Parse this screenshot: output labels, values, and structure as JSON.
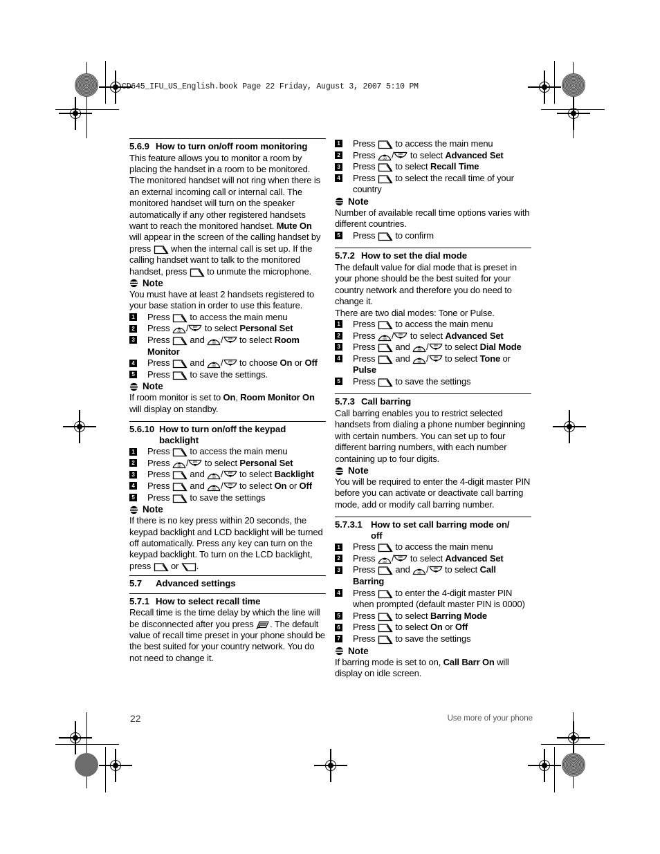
{
  "header": {
    "file_line": "CD645_IFU_US_English.book  Page 22  Friday, August 3, 2007  5:10 PM"
  },
  "footer": {
    "page_number": "22",
    "running_head": "Use more of your phone"
  },
  "icons": {
    "soft_key_left": "left-softkey-icon",
    "soft_key_right": "right-softkey-icon",
    "nav_up": "nav-up-cid-key-icon",
    "nav_down": "nav-down-pbk-key-icon",
    "recall": "recall-flash-key-icon",
    "note": "note-bullet-icon"
  },
  "left_column": {
    "s569": {
      "number": "5.6.9",
      "title": "How to turn on/off room monitoring",
      "paragraph_1a": "This feature allows you to monitor a room by placing the handset in a room to be monitored. The monitored handset will not ring when there is an external incoming call or internal call.  The monitored handset will turn on the speaker automatically if any other registered handsets want to reach the monitored handset. ",
      "mute_on": "Mute On",
      "paragraph_1b": " will appear in the screen of the calling handset by press ",
      "paragraph_1c": " when the internal call is set up. If the calling handset want to talk to the monitored handset, press ",
      "paragraph_1d": " to unmute the microphone.",
      "note_label": "Note",
      "note_text": "You must have at least 2 handsets registered to your base station in order to use this feature.",
      "steps": [
        {
          "n": "1",
          "pre": "Press ",
          "icons": [
            "soft_l"
          ],
          "post": " to access the main menu"
        },
        {
          "n": "2",
          "pre": "Press ",
          "icons": [
            "nav"
          ],
          "post": " to select ",
          "bold": "Personal Set"
        },
        {
          "n": "3",
          "pre": "Press ",
          "icons": [
            "soft_l",
            "nav"
          ],
          "mid": " and ",
          "post": " to select ",
          "bold": "Room",
          "cont": "Monitor"
        },
        {
          "n": "4",
          "pre": "Press ",
          "icons": [
            "soft_l",
            "nav"
          ],
          "mid": " and ",
          "post": " to choose ",
          "bold": "On",
          "post2": " or ",
          "bold2": "Off"
        },
        {
          "n": "5",
          "pre": "Press ",
          "icons": [
            "soft_l"
          ],
          "post": " to save the settings."
        }
      ],
      "note2_label": "Note",
      "note2_a": "If room monitor is set to ",
      "note2_b1": "On",
      "note2_c": ", ",
      "note2_b2": "Room Monitor On",
      "note2_d": " will display on standby."
    },
    "s5610": {
      "number": "5.6.10",
      "title": "How to turn on/off the keypad",
      "title_cont": "backlight",
      "steps": [
        {
          "n": "1",
          "pre": "Press ",
          "icons": [
            "soft_l"
          ],
          "post": " to access the main menu"
        },
        {
          "n": "2",
          "pre": "Press ",
          "icons": [
            "nav"
          ],
          "post": " to select ",
          "bold": "Personal Set"
        },
        {
          "n": "3",
          "pre": "Press ",
          "icons": [
            "soft_l",
            "nav"
          ],
          "mid": " and ",
          "post": " to select ",
          "bold": "Backlight"
        },
        {
          "n": "4",
          "pre": "Press ",
          "icons": [
            "soft_l",
            "nav"
          ],
          "mid": " and ",
          "post": " to select ",
          "bold": "On",
          "post2": " or ",
          "bold2": "Off"
        },
        {
          "n": "5",
          "pre": "Press ",
          "icons": [
            "soft_l"
          ],
          "post": " to save the settings"
        }
      ],
      "note_label": "Note",
      "note_text_a": "If there is no key press within 20 seconds, the keypad backlight and LCD backlight will be turned off automatically.  Press any key can turn on the keypad backlight. To turn on the LCD backlight, press ",
      "note_text_b": " or ",
      "note_text_c": "."
    },
    "s57": {
      "number": "5.7",
      "title": "Advanced settings"
    },
    "s571": {
      "number": "5.7.1",
      "title": "How to select recall time",
      "paragraph_a": "Recall time is the time delay by which the line will be disconnected after you press ",
      "paragraph_b": ". The default value of recall time preset in your phone should be the best suited for your country network. You do not need to change it."
    }
  },
  "right_column": {
    "recall_steps_top": [
      {
        "n": "1",
        "pre": "Press ",
        "icons": [
          "soft_l"
        ],
        "post": " to access the main menu"
      },
      {
        "n": "2",
        "pre": "Press ",
        "icons": [
          "nav"
        ],
        "post": " to select ",
        "bold": "Advanced Set"
      },
      {
        "n": "3",
        "pre": "Press ",
        "icons": [
          "soft_l"
        ],
        "post": " to select ",
        "bold": "Recall Time"
      },
      {
        "n": "4",
        "pre": "Press ",
        "icons": [
          "soft_l"
        ],
        "post": " to select the recall time of your",
        "cont": "country"
      }
    ],
    "note_label": "Note",
    "note_text": "Number of available recall time options varies with different countries.",
    "step_confirm": {
      "n": "5",
      "pre": "Press ",
      "icons": [
        "soft_l"
      ],
      "post": " to confirm"
    },
    "s572": {
      "number": "5.7.2",
      "title": "How to set the dial mode",
      "paragraph_1": "The default value for dial mode that is preset in your phone should be the best suited for your country network and therefore you do need to change it.",
      "paragraph_2": "There are two dial modes: Tone or Pulse.",
      "steps": [
        {
          "n": "1",
          "pre": "Press ",
          "icons": [
            "soft_l"
          ],
          "post": " to access the main menu"
        },
        {
          "n": "2",
          "pre": "Press ",
          "icons": [
            "nav"
          ],
          "post": " to select ",
          "bold": "Advanced Set"
        },
        {
          "n": "3",
          "pre": "Press ",
          "icons": [
            "soft_l",
            "nav"
          ],
          "mid": " and ",
          "post": " to select ",
          "bold": "Dial Mode"
        },
        {
          "n": "4",
          "pre": "Press ",
          "icons": [
            "soft_l",
            "nav"
          ],
          "mid": " and ",
          "post": " to select ",
          "bold": "Tone",
          "post2": " or ",
          "cont": "Pulse"
        },
        {
          "n": "5",
          "pre": "Press ",
          "icons": [
            "soft_l"
          ],
          "post": " to save the settings"
        }
      ]
    },
    "s573": {
      "number": "5.7.3",
      "title": "Call barring",
      "paragraph": "Call barring enables you to restrict selected handsets from dialing a phone number beginning with certain numbers. You can set up to four different barring numbers, with each number containing up to four digits.",
      "note_label": "Note",
      "note_text": "You will be required to enter the 4-digit master PIN before you can activate or deactivate call barring mode, add or modify call barring number."
    },
    "s5731": {
      "number": "5.7.3.1",
      "title": "How to set call barring mode on/",
      "title_cont": "off",
      "steps": [
        {
          "n": "1",
          "pre": "Press ",
          "icons": [
            "soft_l"
          ],
          "post": " to access the main menu"
        },
        {
          "n": "2",
          "pre": "Press ",
          "icons": [
            "nav"
          ],
          "post": " to select ",
          "bold": "Advanced Set"
        },
        {
          "n": "3",
          "pre": "Press ",
          "icons": [
            "soft_l",
            "nav"
          ],
          "mid": " and ",
          "post": " to select ",
          "bold": "Call",
          "cont": "Barring"
        },
        {
          "n": "4",
          "pre": "Press ",
          "icons": [
            "soft_l"
          ],
          "post": " to enter the 4-digit master PIN",
          "cont_plain": "when prompted (default master PIN is 0000)"
        },
        {
          "n": "5",
          "pre": "Press ",
          "icons": [
            "soft_l"
          ],
          "post": " to select ",
          "bold": "Barring Mode"
        },
        {
          "n": "6",
          "pre": "Press ",
          "icons": [
            "soft_l"
          ],
          "post": " to select ",
          "bold": "On",
          "post2": " or ",
          "bold2": "Off"
        },
        {
          "n": "7",
          "pre": "Press ",
          "icons": [
            "soft_l"
          ],
          "post": " to save the settings"
        }
      ],
      "note_label": "Note",
      "note_a": "If barring mode is set to on, ",
      "note_b": "Call Barr On",
      "note_c": " will display on idle screen."
    }
  }
}
